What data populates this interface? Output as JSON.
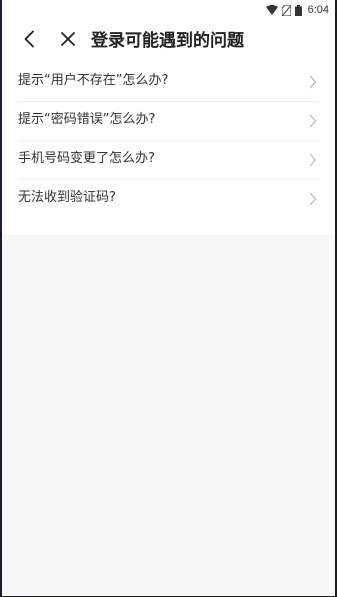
{
  "status_bar": {
    "time": "6:04",
    "icons": [
      "wifi-icon",
      "no-sim-icon",
      "battery-icon"
    ]
  },
  "app_bar": {
    "back_icon": "chevron-left-icon",
    "close_icon": "close-icon",
    "title": "登录可能遇到的问题"
  },
  "faq": {
    "items": [
      {
        "label": "提示“用户不存在”怎么办?"
      },
      {
        "label": "提示“密码错误”怎么办?"
      },
      {
        "label": "手机号码变更了怎么办?"
      },
      {
        "label": "无法收到验证码?"
      }
    ],
    "chevron_icon": "chevron-right-icon"
  },
  "colors": {
    "background": "#f7f7f7",
    "surface": "#ffffff",
    "text": "#222222",
    "divider": "#eeeeee",
    "chevron": "#b8b8b8"
  }
}
